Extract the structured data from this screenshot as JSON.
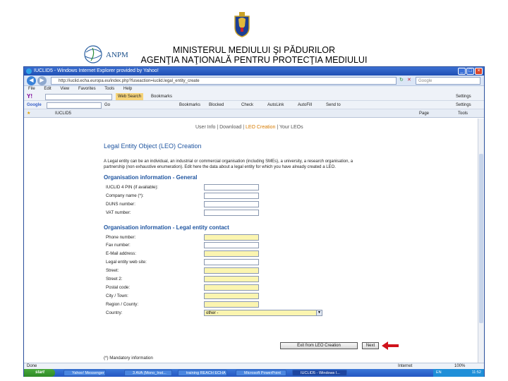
{
  "slide": {
    "line1": "MINISTERUL MEDIULUI ŞI PĂDURILOR",
    "line2": "AGENŢIA NAŢIONALĂ PENTRU PROTECŢIA MEDIULUI",
    "logo_text": "ANPM"
  },
  "browser": {
    "title": "IUCLID5 - Windows Internet Explorer provided by Yahoo!",
    "address": "http://iuclid.echa.europa.eu/index.php?fuseaction=iuclid.legal_entity_create",
    "search_placeholder": "Google",
    "menu": [
      "File",
      "Edit",
      "View",
      "Favorites",
      "Tools",
      "Help"
    ],
    "yahoo_toolbar": {
      "search_btn": "Web Search",
      "bookmarks": "Bookmarks",
      "settings": "Settings",
      "y_logo": "Y!"
    },
    "google_toolbar": {
      "label": "Google",
      "go": "Go",
      "bookmarks": "Bookmarks",
      "blocked": "Blocked",
      "check": "Check",
      "autolink": "AutoLink",
      "autofill": "AutoFill",
      "send": "Send to",
      "settings": "Settings"
    },
    "tab_label": "IUCLID5",
    "cmd": {
      "page": "Page",
      "tools": "Tools"
    },
    "status_left": "Done",
    "status_zone": "Internet",
    "zoom": "100%"
  },
  "page": {
    "nav": {
      "user_info": "User Info",
      "download": "Download",
      "leo_creation": "LEO Creation",
      "your_leos": "Your LEOs",
      "sep": " | "
    },
    "title": "Legal Entity Object (LEO) Creation",
    "intro": "A Legal entity can be an individual, an industrial or commercial organisation (including SMEs), a university, a research organisation, a partnership (non exhaustive enumeration). Edit here the data about a legal entity for which you have already created a LEO.",
    "section_general": "Organisation information - General",
    "general_fields": [
      {
        "label": "IUCLID 4 PIN (if available):",
        "required": false
      },
      {
        "label": "Company name (*):",
        "required": false
      },
      {
        "label": "DUNS number:",
        "required": false
      },
      {
        "label": "VAT number:",
        "required": false
      }
    ],
    "section_contact": "Organisation information - Legal entity contact",
    "contact_fields": [
      {
        "label": "Phone number:",
        "required": true
      },
      {
        "label": "Fax number:",
        "required": false
      },
      {
        "label": "E-Mail address:",
        "required": true
      },
      {
        "label": "Legal entity web site:",
        "required": false
      },
      {
        "label": "Street:",
        "required": true
      },
      {
        "label": "Street 2:",
        "required": true
      },
      {
        "label": "Postal code:",
        "required": true
      },
      {
        "label": "City / Town:",
        "required": true
      },
      {
        "label": "Region / County:",
        "required": true
      }
    ],
    "country_label": "Country:",
    "country_value": "other -",
    "exit_button": "Exit from LEO Creation",
    "next_button": "Next",
    "mandatory_note": "(*) Mandatory information"
  },
  "taskbar": {
    "start": "start",
    "tasks": [
      "Yahoo! Messenger",
      "3 AVA (Mono_Inst...",
      "training REACH ECHA",
      "Microsoft PowerPoint",
      "IUCLID5 - Windows I..."
    ],
    "lang": "EN",
    "clock": "11:52"
  },
  "colors": {
    "required_field": "#fbf5b0",
    "section_blue": "#1f55a0",
    "nav_active": "#d67b00",
    "arrow": "#d0121b"
  }
}
